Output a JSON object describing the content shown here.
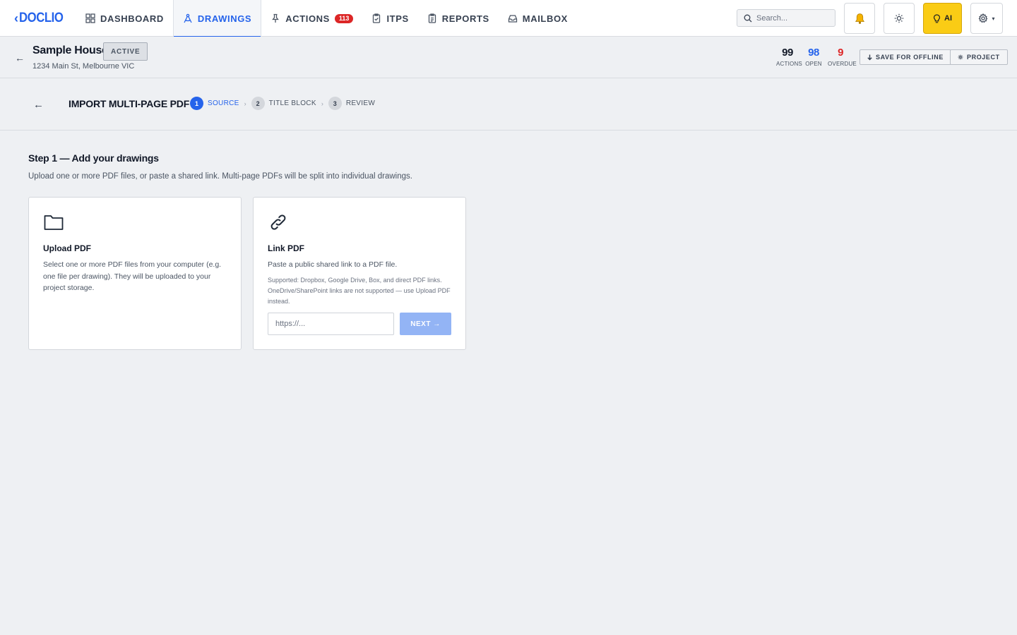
{
  "app": {
    "logo_text": "DOCLIO",
    "brand_color": "#2563eb"
  },
  "nav": {
    "items": [
      {
        "label": "DASHBOARD",
        "icon": "grid-icon",
        "active": false
      },
      {
        "label": "DRAWINGS",
        "icon": "compass-icon",
        "active": true
      },
      {
        "label": "ACTIONS",
        "icon": "pin-icon",
        "active": false,
        "badge": "113"
      },
      {
        "label": "ITPS",
        "icon": "clipboard-check-icon",
        "active": false
      },
      {
        "label": "REPORTS",
        "icon": "clipboard-list-icon",
        "active": false
      },
      {
        "label": "MAILBOX",
        "icon": "inbox-icon",
        "active": false
      }
    ],
    "search_placeholder": "Search...",
    "ai_label": "AI",
    "gear_caret": "▾"
  },
  "project": {
    "name": "Sample House",
    "status": "ACTIVE",
    "address": "1234 Main St, Melbourne VIC",
    "stats": [
      {
        "value": "99",
        "label": "ACTIONS",
        "color": "#111827"
      },
      {
        "value": "98",
        "label": "OPEN",
        "color": "#2563eb"
      },
      {
        "value": "9",
        "label": "OVERDUE",
        "color": "#dc2626"
      }
    ],
    "save_offline_label": "SAVE FOR OFFLINE",
    "project_label": "PROJECT"
  },
  "wizard": {
    "title": "IMPORT MULTI-PAGE PDF",
    "steps": [
      {
        "number": "1",
        "label": "SOURCE",
        "active": true
      },
      {
        "number": "2",
        "label": "TITLE BLOCK",
        "active": false
      },
      {
        "number": "3",
        "label": "REVIEW",
        "active": false
      }
    ]
  },
  "content": {
    "heading": "Step 1 — Add your drawings",
    "description": "Upload one or more PDF files, or paste a shared link. Multi-page PDFs will be split into individual drawings.",
    "upload_card": {
      "title": "Upload PDF",
      "description": "Select one or more PDF files from your computer (e.g. one file per drawing). They will be uploaded to your project storage."
    },
    "link_card": {
      "title": "Link PDF",
      "description": "Paste a public shared link to a PDF file.",
      "note": "Supported: Dropbox, Google Drive, Box, and direct PDF links. OneDrive/SharePoint links are not supported — use Upload PDF instead.",
      "input_placeholder": "https://...",
      "input_value": "",
      "next_label": "NEXT →"
    }
  }
}
